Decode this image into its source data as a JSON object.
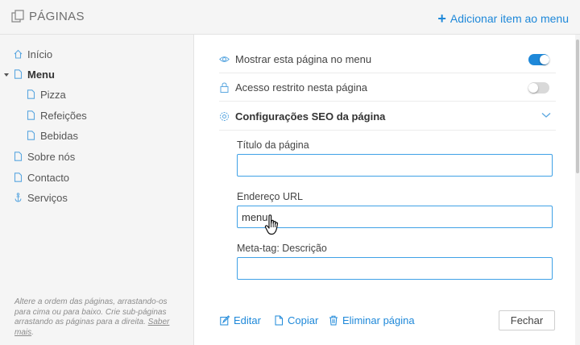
{
  "header": {
    "title": "PÁGINAS",
    "add_label": "Adicionar item ao menu",
    "add_icon": "plus-icon"
  },
  "sidebar": {
    "items": [
      {
        "label": "Início",
        "icon": "home-icon",
        "level": 0
      },
      {
        "label": "Menu",
        "icon": "page-icon",
        "level": 0,
        "active": true,
        "expanded": true
      },
      {
        "label": "Pizza",
        "icon": "page-icon",
        "level": 1
      },
      {
        "label": "Refeições",
        "icon": "page-icon",
        "level": 1
      },
      {
        "label": "Bebidas",
        "icon": "page-icon",
        "level": 1
      },
      {
        "label": "Sobre nós",
        "icon": "page-icon",
        "level": 0
      },
      {
        "label": "Contacto",
        "icon": "page-icon",
        "level": 0
      },
      {
        "label": "Serviços",
        "icon": "anchor-icon",
        "level": 0
      }
    ],
    "help_text": "Altere a ordem das páginas, arrastando-os para cima ou para baixo. Crie sub-páginas arrastando as páginas para a direita.",
    "help_link": "Saber mais"
  },
  "settings": {
    "show_in_menu": {
      "label": "Mostrar esta página no menu",
      "enabled": true,
      "icon": "eye-icon"
    },
    "restricted": {
      "label": "Acesso restrito nesta página",
      "enabled": false,
      "icon": "lock-icon"
    },
    "seo": {
      "label": "Configurações SEO da página",
      "icon": "gear-icon",
      "expanded": true
    }
  },
  "seo_form": {
    "title_label": "Título da página",
    "title_value": "",
    "url_label": "Endereço URL",
    "url_value": "menu",
    "meta_label": "Meta-tag: Descrição",
    "meta_value": ""
  },
  "actions": {
    "edit": "Editar",
    "copy": "Copiar",
    "delete": "Eliminar página",
    "close": "Fechar"
  },
  "colors": {
    "accent": "#1e88d9",
    "sidebar_bg": "#f5f5f5",
    "input_border": "#3fa1e6"
  }
}
